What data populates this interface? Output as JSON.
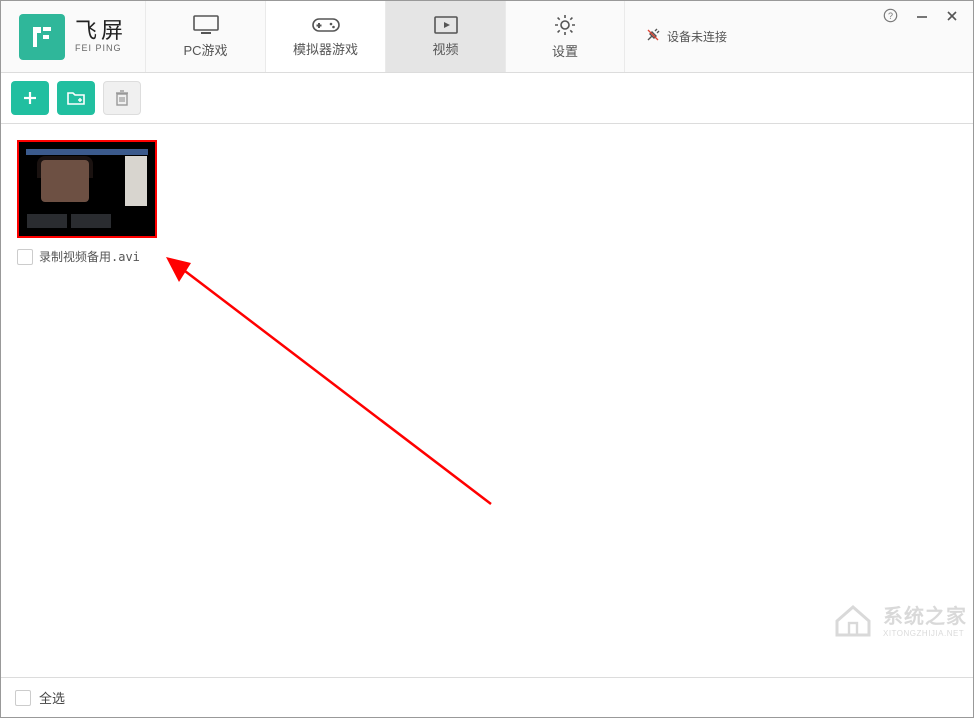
{
  "app": {
    "name_cn": "飞屏",
    "name_en": "FEI PING"
  },
  "tabs": {
    "pc_games": "PC游戏",
    "emu_games": "模拟器游戏",
    "video": "视频",
    "settings": "设置"
  },
  "status": {
    "device": "设备未连接"
  },
  "toolbar": {
    "add": "add",
    "add_folder": "add-folder",
    "delete": "delete"
  },
  "videos": {
    "item0": {
      "filename": "录制视频备用.avi"
    }
  },
  "footer": {
    "select_all": "全选"
  },
  "watermark": {
    "cn": "系统之家",
    "en": "XITONGZHIJIA.NET"
  }
}
